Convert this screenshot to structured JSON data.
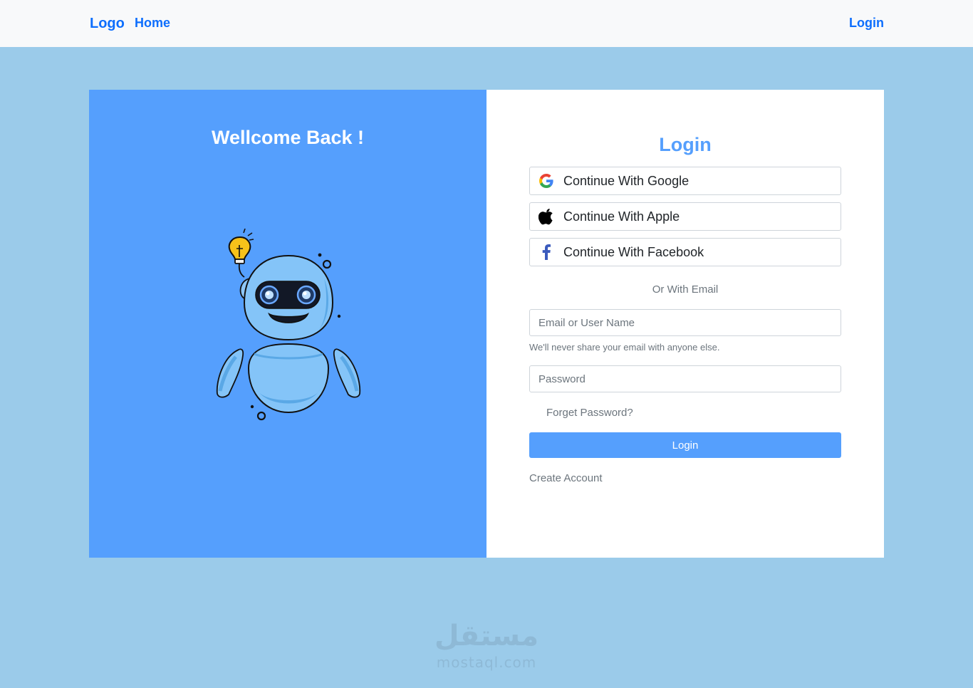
{
  "navbar": {
    "logo": "Logo",
    "home": "Home",
    "login": "Login"
  },
  "left_panel": {
    "title": "Wellcome Back !"
  },
  "login_form": {
    "title": "Login",
    "google_label": "Continue With Google",
    "apple_label": "Continue With Apple",
    "facebook_label": "Continue With Facebook",
    "or_email": "Or With Email",
    "email_placeholder": "Email or User Name",
    "help_text": "We'll never share your email with anyone else.",
    "password_placeholder": "Password",
    "forget_password": "Forget Password?",
    "login_button": "Login",
    "create_account": "Create Account"
  },
  "watermark": {
    "arabic": "مستقل",
    "latin": "mostaql.com"
  },
  "colors": {
    "page_bg": "#9bcbea",
    "accent": "#559ffd",
    "nav_link": "#0d6efd"
  },
  "icons": [
    "google-icon",
    "apple-icon",
    "facebook-icon",
    "robot-illustration"
  ]
}
